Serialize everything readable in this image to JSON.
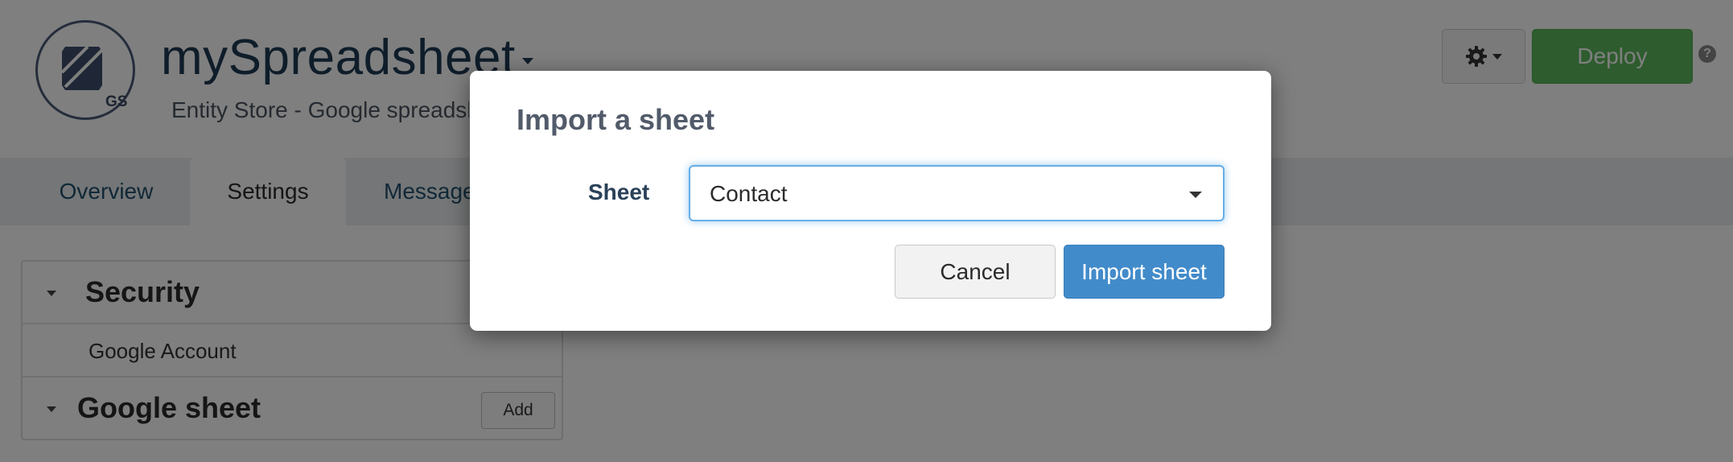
{
  "app": {
    "logo_text": "GS",
    "title": "mySpreadsheet",
    "subtitle": "Entity Store - Google spreadsh"
  },
  "toolbar": {
    "deploy_label": "Deploy",
    "help_symbol": "?"
  },
  "tabs": [
    {
      "label": "Overview"
    },
    {
      "label": "Settings"
    },
    {
      "label": "Messages"
    }
  ],
  "panel": {
    "security_title": "Security",
    "security_item": "Google Account",
    "google_sheet_title": "Google sheet",
    "add_label": "Add"
  },
  "modal": {
    "title": "Import a sheet",
    "sheet_label": "Sheet",
    "sheet_value": "Contact",
    "cancel_label": "Cancel",
    "import_label": "Import sheet"
  },
  "colors": {
    "deploy_green": "#5cb85c",
    "import_blue": "#428bca",
    "title_navy": "#1f3a55",
    "focus_ring": "#66afe9"
  },
  "icons": [
    "gear-icon",
    "chevron-down-icon",
    "help-icon",
    "caret-down-icon"
  ]
}
